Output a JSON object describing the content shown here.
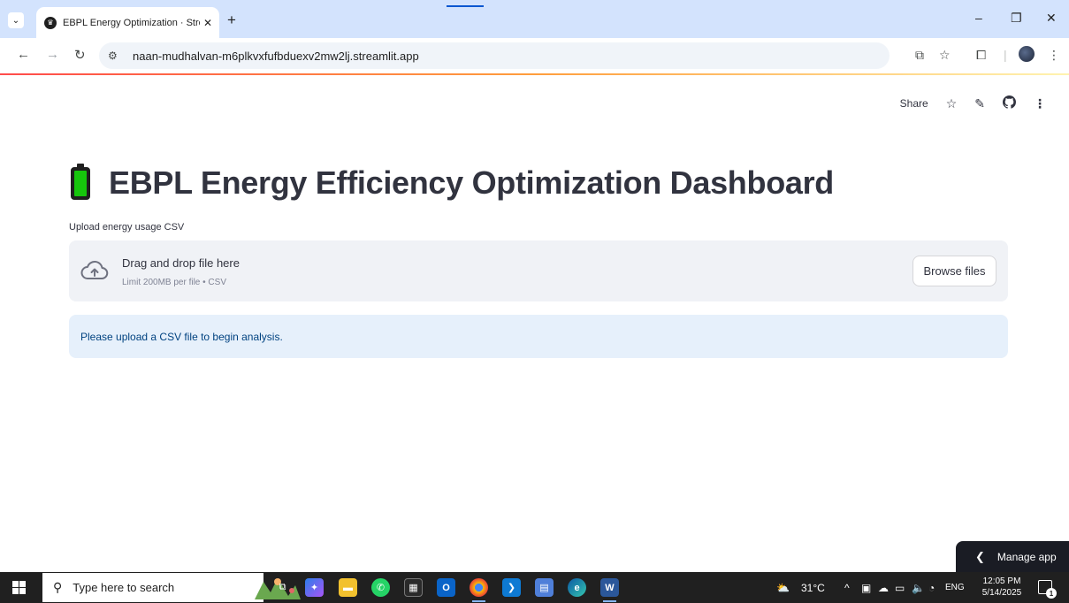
{
  "browser": {
    "tab_title": "EBPL Energy Optimization · Stre",
    "tab_close": "✕",
    "new_tab": "+",
    "url": "naan-mudhalvan-m6plkvxfufbduexv2mw2lj.streamlit.app",
    "window_controls": {
      "minimize": "–",
      "restore": "❐",
      "close": "✕"
    }
  },
  "streamlit_header": {
    "share_label": "Share"
  },
  "main": {
    "title_icon": "battery-icon",
    "title": "EBPL Energy Efficiency Optimization Dashboard",
    "uploader": {
      "label": "Upload energy usage CSV",
      "drop_text": "Drag and drop file here",
      "limit_text": "Limit 200MB per file • CSV",
      "browse_label": "Browse files"
    },
    "info_message": "Please upload a CSV file to begin analysis."
  },
  "manage_app": {
    "label": "Manage app"
  },
  "taskbar": {
    "search_placeholder": "Type here to search",
    "weather": "31°C",
    "language": "ENG",
    "time": "12:05 PM",
    "date": "5/14/2025",
    "notification_count": "1"
  },
  "colors": {
    "tabstrip": "#d3e3fd",
    "streamlit_red": "#ff4b4b",
    "title_text": "#31333f",
    "dropzone_bg": "#f0f2f6",
    "info_bg": "#e6f0fb",
    "info_text": "#004280",
    "battery_green": "#16c60c",
    "taskbar": "#202020"
  }
}
